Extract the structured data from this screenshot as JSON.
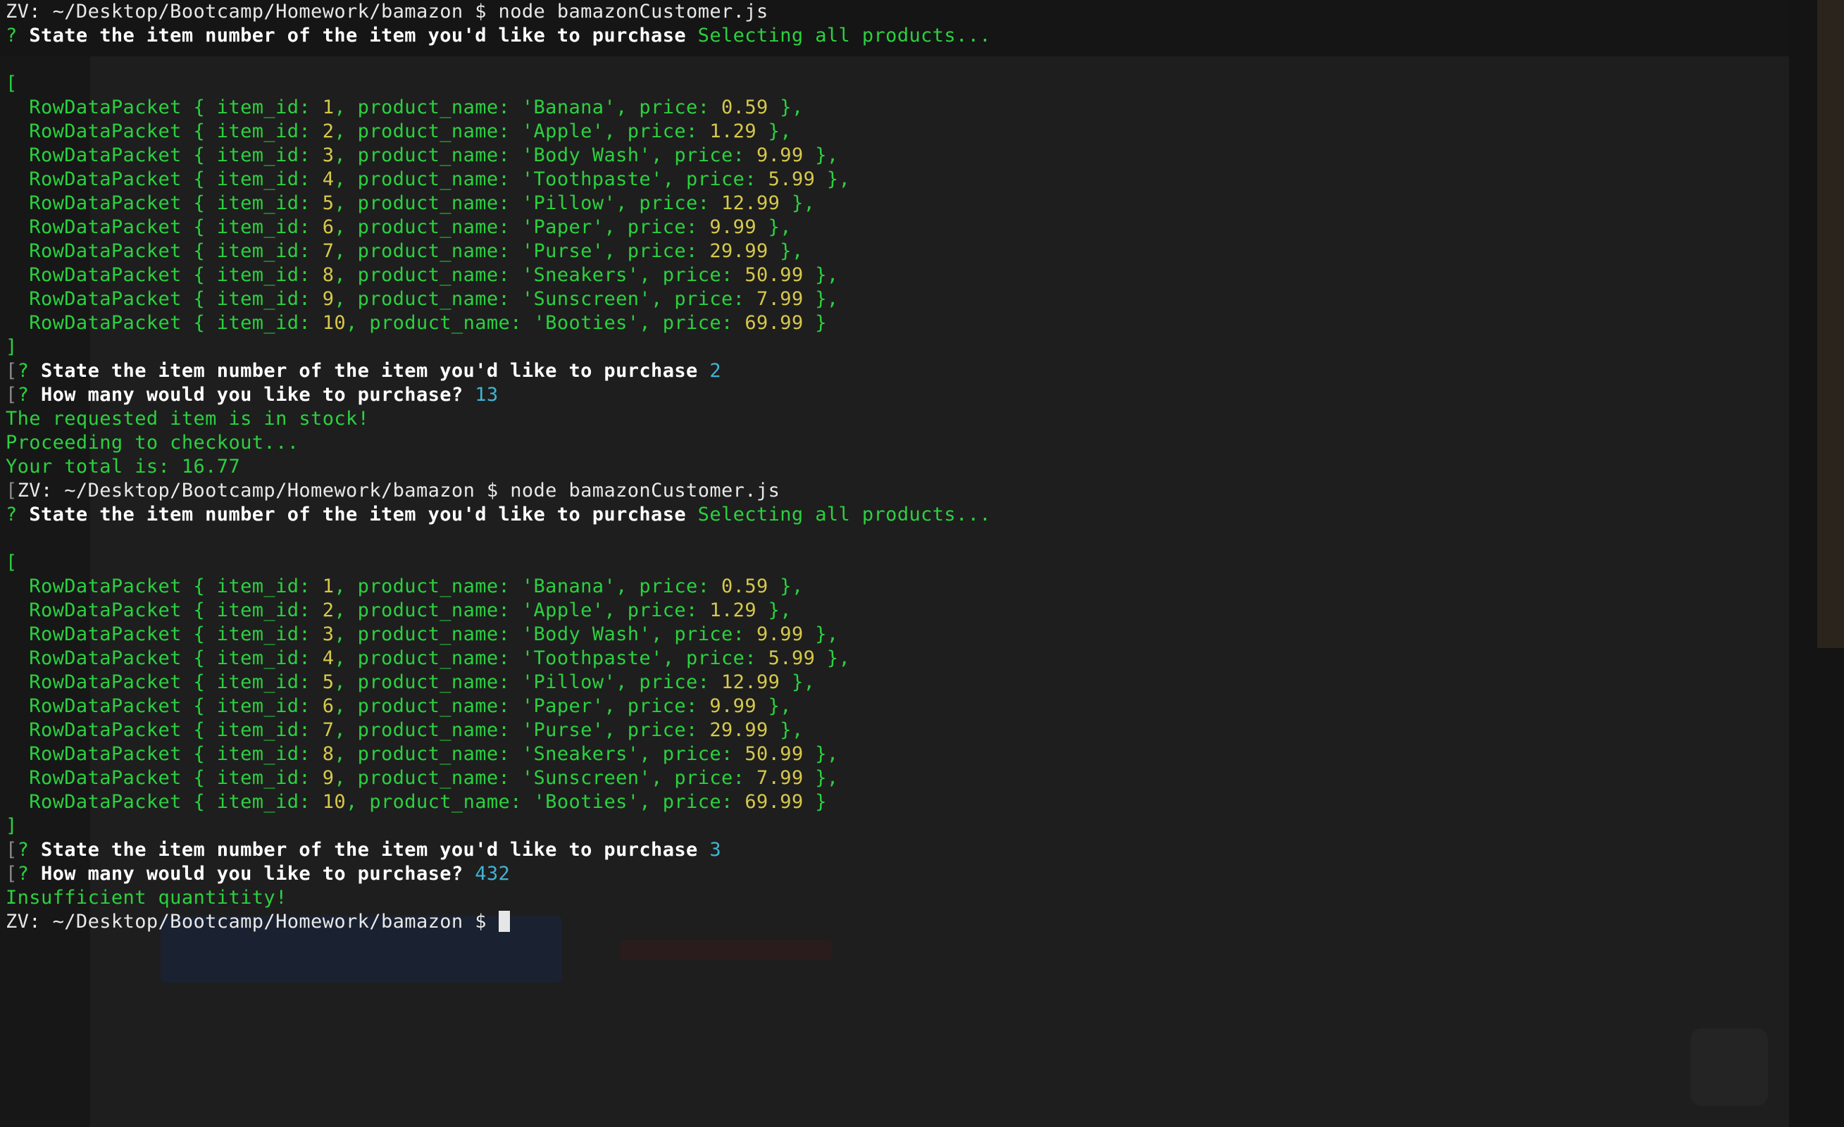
{
  "prompt": {
    "host": "ZV:",
    "path": "~/Desktop/Bootcamp/Homework/bamazon",
    "symbol": "$",
    "command": "node bamazonCustomer.js"
  },
  "questions": {
    "item_number": "State the item number of the item you'd like to purchase",
    "quantity": "How many would you like to purchase?"
  },
  "status": {
    "selecting": "Selecting all products..."
  },
  "products": [
    {
      "id": "1",
      "name": "'Banana'",
      "price": "0.59",
      "tail": "},"
    },
    {
      "id": "2",
      "name": "'Apple'",
      "price": "1.29",
      "tail": "},"
    },
    {
      "id": "3",
      "name": "'Body Wash'",
      "price": "9.99",
      "tail": "},"
    },
    {
      "id": "4",
      "name": "'Toothpaste'",
      "price": "5.99",
      "tail": "},"
    },
    {
      "id": "5",
      "name": "'Pillow'",
      "price": "12.99",
      "tail": "},"
    },
    {
      "id": "6",
      "name": "'Paper'",
      "price": "9.99",
      "tail": "},"
    },
    {
      "id": "7",
      "name": "'Purse'",
      "price": "29.99",
      "tail": "},"
    },
    {
      "id": "8",
      "name": "'Sneakers'",
      "price": "50.99",
      "tail": "},"
    },
    {
      "id": "9",
      "name": "'Sunscreen'",
      "price": "7.99",
      "tail": "},"
    },
    {
      "id": "10",
      "name": "'Booties'",
      "price": "69.99",
      "tail": "}"
    }
  ],
  "runs": [
    {
      "answer_item": "2",
      "answer_qty": "13",
      "results": [
        "The requested item is in stock!",
        "Proceeding to checkout...",
        "Your total is: 16.77"
      ]
    },
    {
      "answer_item": "3",
      "answer_qty": "432",
      "results": [
        "Insufficient quantitity!"
      ]
    }
  ],
  "colors": {
    "green": "#2bd13f",
    "yellow": "#d6c84b",
    "cyan": "#41b3d2",
    "background": "#1e1e1e"
  }
}
